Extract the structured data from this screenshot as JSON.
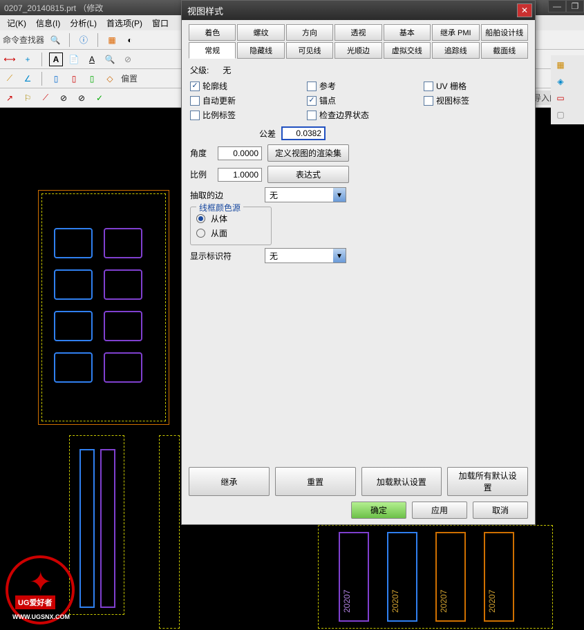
{
  "app": {
    "title": "0207_20140815.prt （修改",
    "menu": [
      "记(K)",
      "信息(I)",
      "分析(L)",
      "首选项(P)",
      "窗口"
    ],
    "cmd_finder_label": "命令查找器",
    "view_label": "导入的视图"
  },
  "dialog": {
    "title": "视图样式",
    "tabs_row1": [
      "着色",
      "螺纹",
      "方向",
      "透视",
      "基本",
      "继承 PMI",
      "船舶设计线"
    ],
    "tabs_row2": [
      "常规",
      "隐藏线",
      "可见线",
      "光顺边",
      "虚拟交线",
      "追踪线",
      "截面线"
    ],
    "active_tab": "常规",
    "parent_label": "父级:",
    "parent_value": "无",
    "checks": {
      "contour": {
        "label": "轮廓线",
        "checked": true
      },
      "reference": {
        "label": "参考",
        "checked": false
      },
      "uvgrid": {
        "label": "UV 栅格",
        "checked": false
      },
      "autoupdate": {
        "label": "自动更新",
        "checked": false
      },
      "anchor": {
        "label": "锚点",
        "checked": true
      },
      "viewlabel": {
        "label": "视图标签",
        "checked": false
      },
      "scalelabel": {
        "label": "比例标签",
        "checked": false
      },
      "checkbound": {
        "label": "检查边界状态",
        "checked": false
      }
    },
    "tolerance_label": "公差",
    "tolerance_value": "0.0382",
    "angle_label": "角度",
    "angle_value": "0.0000",
    "render_set_btn": "定义视图的渲染集",
    "scale_label": "比例",
    "scale_value": "1.0000",
    "expression_btn": "表达式",
    "extract_edge_label": "抽取的边",
    "extract_edge_value": "无",
    "wireframe_group": "线框颜色源",
    "radio_body": {
      "label": "从体",
      "checked": true
    },
    "radio_face": {
      "label": "从面",
      "checked": false
    },
    "show_marker_label": "显示标识符",
    "show_marker_value": "无",
    "footer_btns": [
      "继承",
      "重置",
      "加载默认设置",
      "加载所有默认设置"
    ],
    "ok_btn": "确定",
    "apply_btn": "应用",
    "cancel_btn": "取消"
  },
  "cad_labels": [
    "20207",
    "20207",
    "20207",
    "20207"
  ],
  "logo": {
    "brand": "UG爱好者",
    "url": "WWW.UGSNX.COM"
  }
}
